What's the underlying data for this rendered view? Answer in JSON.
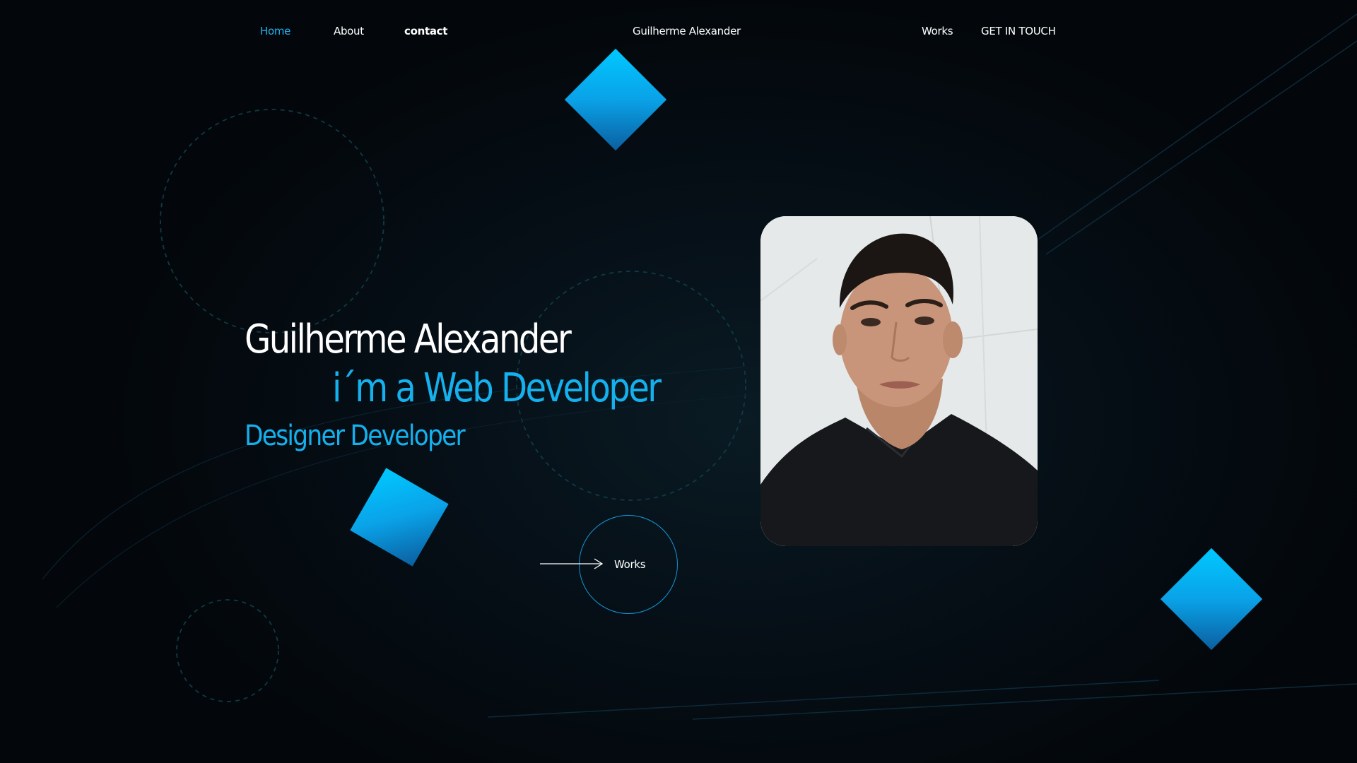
{
  "nav": {
    "home_label": "Home",
    "about_label": "About",
    "contact_label": "contact",
    "brand_label": "Guilherme Alexander",
    "works_label": "Works",
    "get_in_touch_label": "GET IN TOUCH"
  },
  "hero": {
    "name": "Guilherme Alexander",
    "role": "i´m a Web Developer",
    "subtitle": "Designer Developer"
  },
  "cta": {
    "works_label": "Works"
  },
  "colors": {
    "background": "#04070b",
    "accent": "#14b1ee",
    "text": "#ffffff"
  },
  "icons": {
    "cta_arrow": "arrow-right-icon"
  }
}
